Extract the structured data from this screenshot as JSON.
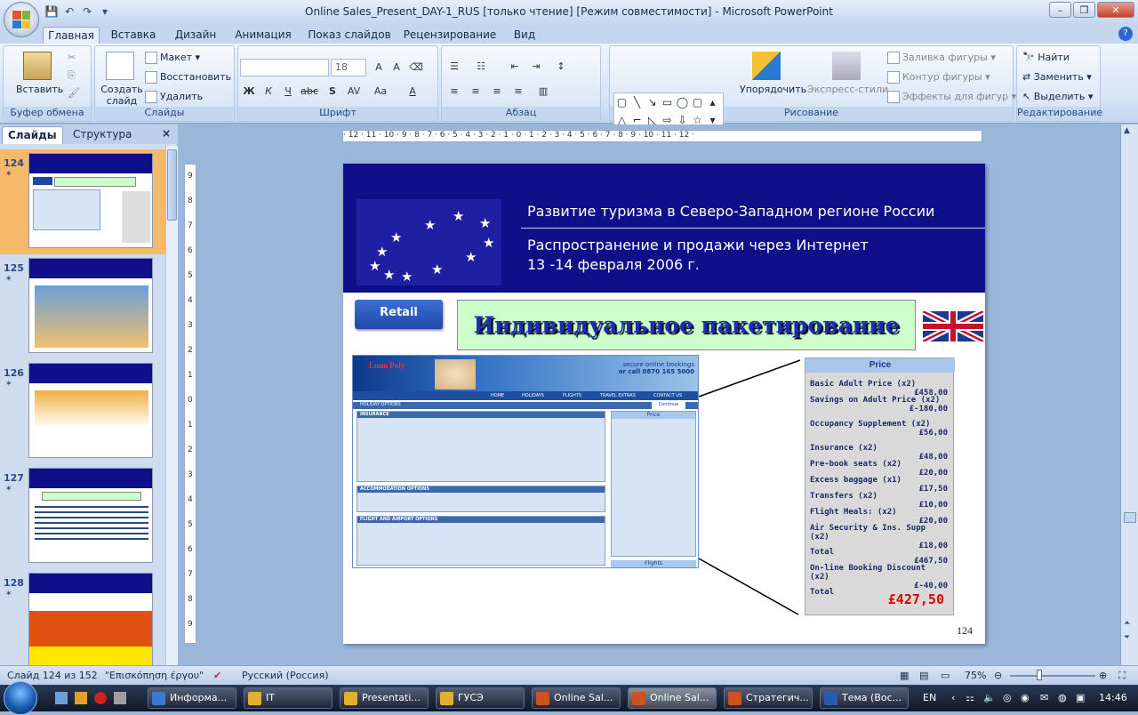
{
  "window": {
    "title": "Online Sales_Present_DAY-1_RUS [только чтение] [Режим совместимости] - Microsoft PowerPoint"
  },
  "ribbon_tabs": [
    "Главная",
    "Вставка",
    "Дизайн",
    "Анимация",
    "Показ слайдов",
    "Рецензирование",
    "Вид"
  ],
  "ribbon": {
    "clipboard": {
      "paste": "Вставить",
      "label": "Буфер обмена"
    },
    "slides": {
      "new_slide": "Создать слайд",
      "layout": "Макет",
      "reset": "Восстановить",
      "delete": "Удалить",
      "label": "Слайды"
    },
    "font": {
      "size": "18",
      "label": "Шрифт"
    },
    "paragraph": {
      "label": "Абзац"
    },
    "drawing": {
      "arrange": "Упорядочить",
      "quick_styles": "Экспресс-стили",
      "fill": "Заливка фигуры",
      "outline": "Контур фигуры",
      "effects": "Эффекты для фигур",
      "label": "Рисование"
    },
    "editing": {
      "find": "Найти",
      "replace": "Заменить",
      "select": "Выделить",
      "label": "Редактирование"
    }
  },
  "left_pane": {
    "tab_slides": "Слайды",
    "tab_outline": "Структура",
    "close": "×",
    "thumbnails": [
      {
        "number": "124",
        "selected": true
      },
      {
        "number": "125",
        "selected": false
      },
      {
        "number": "126",
        "selected": false
      },
      {
        "number": "127",
        "selected": false
      },
      {
        "number": "128",
        "selected": false
      }
    ]
  },
  "slide": {
    "header_line1": "Развитие туризма в Северо-Западном регионе России",
    "header_line2": "Распространение и продажи через Интернет",
    "header_line3": "13 -14 февраля 2006 г.",
    "retail_badge": "Retail",
    "title": "Индивидуальное пакетирование",
    "page_number": "124",
    "website": {
      "brand": "Lunn Poly",
      "secure_line1": "secure online bookings",
      "secure_line2": "or call 0870 165 5000",
      "nav": [
        "HOME",
        "HOLIDAYS",
        "FLIGHTS",
        "TRAVEL EXTRAS",
        "CONTACT US"
      ],
      "holiday_options": "HOLIDAY OPTIONS",
      "insurance": "INSURANCE",
      "accommodation_options": "ACCOMMODATION OPTIONS",
      "flight_options": "FLIGHT AND AIRPORT OPTIONS",
      "price_header": "Price",
      "flights_tab": "Flights",
      "continue": "Continue"
    },
    "price_panel": {
      "header": "Price",
      "items": [
        {
          "label": "Basic Adult Price (x2)",
          "value": "£458,00"
        },
        {
          "label": "Savings on Adult Price (x2)",
          "value": "£-180,00"
        },
        {
          "label": "Occupancy Supplement (x2)",
          "value": "£56,00"
        },
        {
          "label": "Insurance (x2)",
          "value": "£48,00"
        },
        {
          "label": "Pre-book seats (x2)",
          "value": "£20,00"
        },
        {
          "label": "Excess baggage (x1)",
          "value": "£17,50"
        },
        {
          "label": "Transfers (x2)",
          "value": "£10,00"
        },
        {
          "label": "Flight Meals: (x2)",
          "value": "£20,00"
        },
        {
          "label": "Air Security & Ins. Supp (x2)",
          "value": "£18,00"
        },
        {
          "label": "Total",
          "value": "£467,50"
        },
        {
          "label": "On-line Booking Discount (x2)",
          "value": "£-40,00"
        },
        {
          "label": "Total",
          "value": ""
        }
      ],
      "grand_total": "£427,50"
    }
  },
  "statusbar": {
    "slide_info": "Слайд 124 из 152",
    "theme": "\"Επισκόπηση έργου\"",
    "language": "Русский (Россия)",
    "zoom": "75%"
  },
  "taskbar": {
    "buttons": [
      "Информа...",
      "IT",
      "Presentati...",
      "ГУСЭ",
      "Online Sal...",
      "Online Sal...",
      "Стратегич...",
      "Тема (Вос..."
    ],
    "lang": "EN",
    "time": "14:46"
  },
  "colors": {
    "slide_header": "#0f0f8a",
    "title_bg": "#ccffcc",
    "total_red": "#e00000"
  }
}
